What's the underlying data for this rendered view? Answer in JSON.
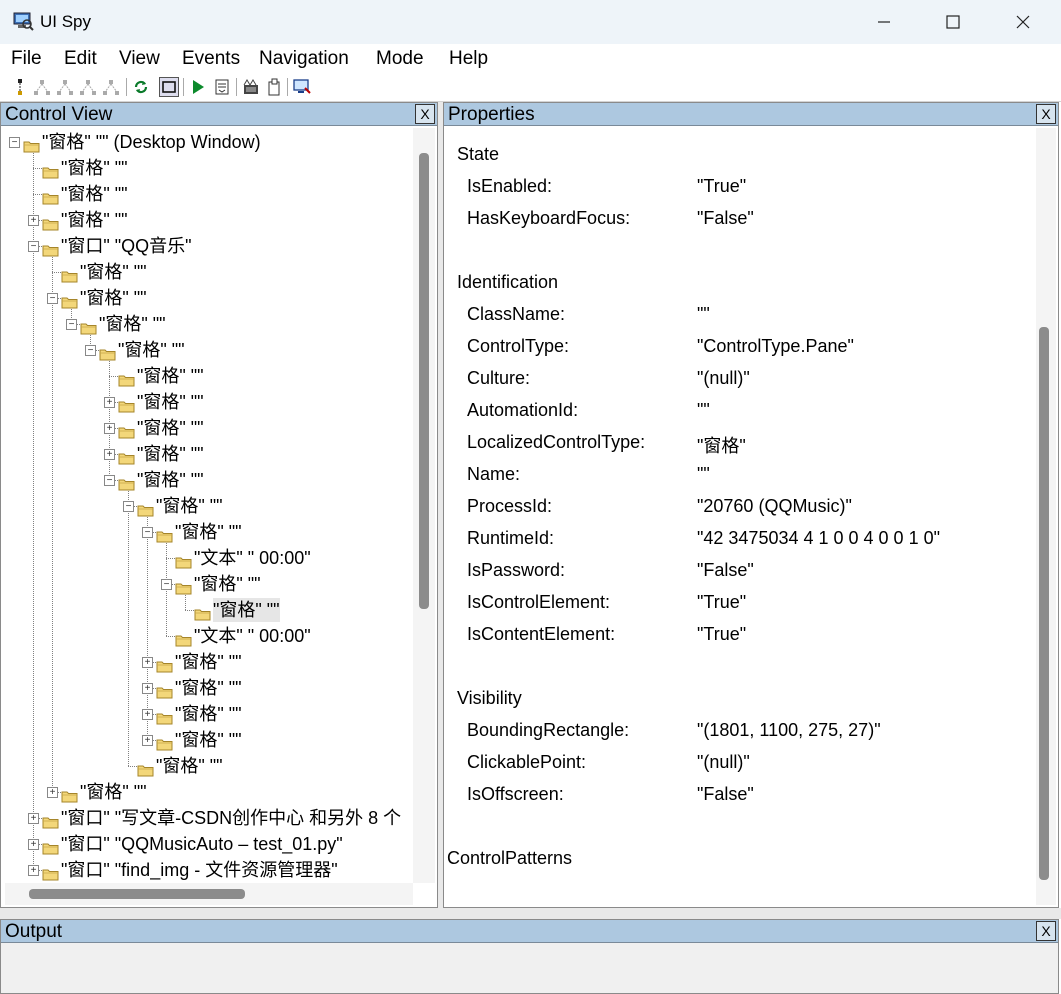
{
  "window": {
    "title": "UI Spy"
  },
  "menu": [
    "File",
    "Edit",
    "View",
    "Events",
    "Navigation",
    "Mode",
    "Help"
  ],
  "toolbar": {
    "buttons": [
      "select-parent-icon",
      "select-first-child-icon",
      "select-previous-icon",
      "select-next-icon",
      "select-last-child-icon",
      "refresh-icon",
      "highlight-rectangle-icon",
      "play-icon",
      "step-icon",
      "record-icon",
      "clipboard-icon",
      "screenshot-icon"
    ]
  },
  "control_view": {
    "title": "Control View",
    "close": "X",
    "tree": [
      {
        "label": "\"窗格\" \"\" (Desktop Window)",
        "expander": "−"
      },
      {
        "label": "\"窗格\" \"\"",
        "expander": ""
      },
      {
        "label": "\"窗格\" \"\"",
        "expander": ""
      },
      {
        "label": "\"窗格\" \"\"",
        "expander": "+"
      },
      {
        "label": "\"窗口\" \"QQ音乐\"",
        "expander": "−"
      },
      {
        "label": "\"窗格\" \"\"",
        "expander": ""
      },
      {
        "label": "\"窗格\" \"\"",
        "expander": "−"
      },
      {
        "label": "\"窗格\" \"\"",
        "expander": "−"
      },
      {
        "label": "\"窗格\" \"\"",
        "expander": "−"
      },
      {
        "label": "\"窗格\" \"\"",
        "expander": ""
      },
      {
        "label": "\"窗格\" \"\"",
        "expander": "+"
      },
      {
        "label": "\"窗格\" \"\"",
        "expander": "+"
      },
      {
        "label": "\"窗格\" \"\"",
        "expander": "+"
      },
      {
        "label": "\"窗格\" \"\"",
        "expander": "−"
      },
      {
        "label": "\"窗格\" \"\"",
        "expander": "−"
      },
      {
        "label": "\"窗格\" \"\"",
        "expander": "−"
      },
      {
        "label": "\"文本\" \" 00:00\"",
        "expander": ""
      },
      {
        "label": "\"窗格\" \"\"",
        "expander": "−"
      },
      {
        "label": "\"窗格\" \"\"",
        "expander": ""
      },
      {
        "label": "\"文本\" \" 00:00\"",
        "expander": ""
      },
      {
        "label": "\"窗格\" \"\"",
        "expander": "+"
      },
      {
        "label": "\"窗格\" \"\"",
        "expander": "+"
      },
      {
        "label": "\"窗格\" \"\"",
        "expander": "+"
      },
      {
        "label": "\"窗格\" \"\"",
        "expander": "+"
      },
      {
        "label": "\"窗格\" \"\"",
        "expander": ""
      },
      {
        "label": "\"窗格\" \"\"",
        "expander": "+"
      },
      {
        "label": "\"窗口\" \"写文章-CSDN创作中心 和另外 8 个",
        "expander": "+"
      },
      {
        "label": "\"窗口\" \"QQMusicAuto – test_01.py\"",
        "expander": "+"
      },
      {
        "label": "\"窗口\" \"find_img - 文件资源管理器\"",
        "expander": "+"
      }
    ]
  },
  "properties": {
    "title": "Properties",
    "close": "X",
    "state": {
      "heading": "State",
      "rows": [
        {
          "name": "IsEnabled:",
          "value": "\"True\""
        },
        {
          "name": "HasKeyboardFocus:",
          "value": "\"False\""
        }
      ]
    },
    "identification": {
      "heading": "Identification",
      "rows": [
        {
          "name": "ClassName:",
          "value": "\"\""
        },
        {
          "name": "ControlType:",
          "value": "\"ControlType.Pane\""
        },
        {
          "name": "Culture:",
          "value": "\"(null)\""
        },
        {
          "name": "AutomationId:",
          "value": "\"\""
        },
        {
          "name": "LocalizedControlType:",
          "value": "\"窗格\""
        },
        {
          "name": "Name:",
          "value": "\"\""
        },
        {
          "name": "ProcessId:",
          "value": "\"20760 (QQMusic)\""
        },
        {
          "name": "RuntimeId:",
          "value": "\"42 3475034 4 1 0 0 4 0 0 1 0\""
        },
        {
          "name": "IsPassword:",
          "value": "\"False\""
        },
        {
          "name": "IsControlElement:",
          "value": "\"True\""
        },
        {
          "name": "IsContentElement:",
          "value": "\"True\""
        }
      ]
    },
    "visibility": {
      "heading": "Visibility",
      "rows": [
        {
          "name": "BoundingRectangle:",
          "value": "\"(1801, 1100, 275, 27)\""
        },
        {
          "name": "ClickablePoint:",
          "value": "\"(null)\""
        },
        {
          "name": "IsOffscreen:",
          "value": "\"False\""
        }
      ]
    },
    "control_patterns": {
      "heading": "ControlPatterns"
    }
  },
  "output": {
    "title": "Output",
    "close": "X"
  }
}
